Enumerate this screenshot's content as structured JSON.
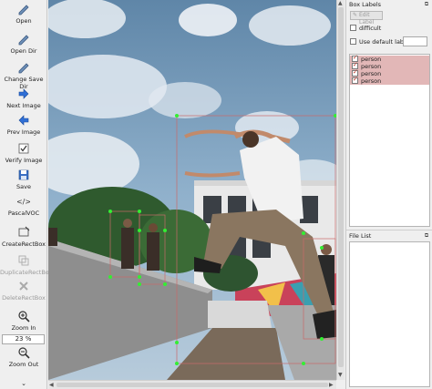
{
  "toolbar": {
    "open": "Open",
    "open_dir": "Open Dir",
    "change_save_dir": "Change Save Dir",
    "next_image": "Next Image",
    "prev_image": "Prev Image",
    "verify_image": "Verify Image",
    "save": "Save",
    "format": "PascalVOC",
    "create_rectbox": "CreateRectBox",
    "duplicate_rectbox": "DuplicateRectBox",
    "delete_rectbox": "DeleteRectBox",
    "zoom_in": "Zoom In",
    "zoom_level": "23 %",
    "zoom_out": "Zoom Out"
  },
  "dock": {
    "box_labels_title": "Box Labels",
    "edit_label": "Edit Label",
    "difficult": "difficult",
    "use_default_label": "Use default label",
    "default_label_value": "",
    "labels": [
      {
        "text": "person",
        "checked": true
      },
      {
        "text": "person",
        "checked": true
      },
      {
        "text": "person",
        "checked": true
      },
      {
        "text": "person",
        "checked": true
      }
    ],
    "file_list_title": "File List"
  },
  "colors": {
    "box_outline": "#33dd33",
    "label_row_bg": "#e2b7b7"
  }
}
